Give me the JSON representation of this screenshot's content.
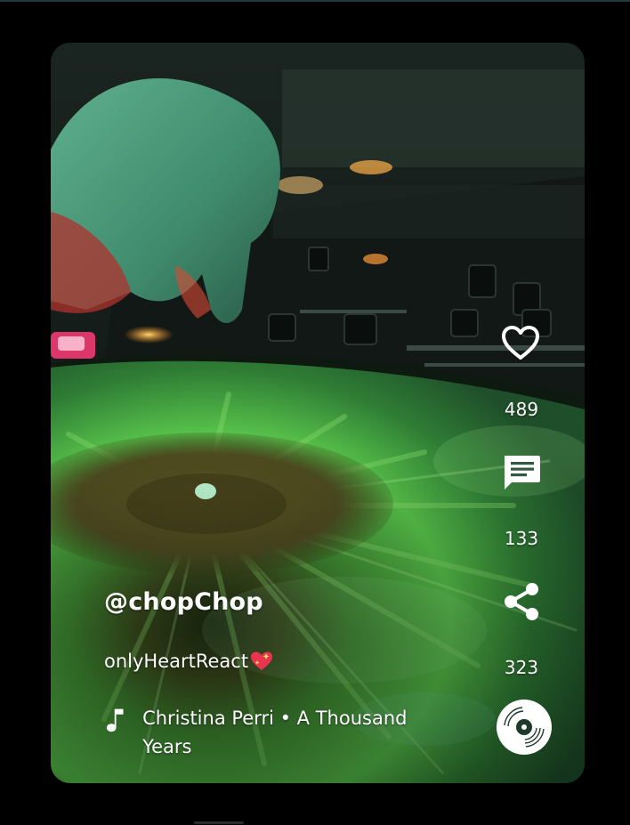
{
  "post": {
    "username": "@chopChop",
    "caption": "onlyHeartReact",
    "caption_emoji": "sparkling-heart",
    "music_track": "Christina Perri • A Thousand Years"
  },
  "actions": {
    "like": {
      "icon": "heart-outline-icon",
      "count": "489"
    },
    "comment": {
      "icon": "comment-bubble-icon",
      "count": "133"
    },
    "share": {
      "icon": "share-icon",
      "count": "323"
    },
    "sound": {
      "icon": "vinyl-disc-icon"
    }
  },
  "colors": {
    "background": "#000000",
    "text": "#ffffff",
    "accent_green": "#3fbf5a"
  }
}
